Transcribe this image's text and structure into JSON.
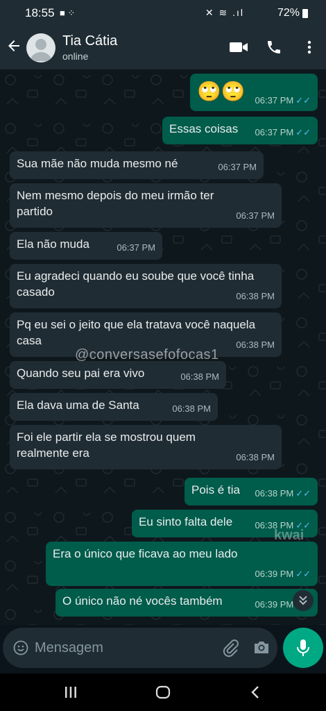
{
  "status_bar": {
    "time": "18:55",
    "left_icons": "■ ⁘",
    "system_icons": "✕ ≋ .ıl",
    "battery": "72%"
  },
  "header": {
    "contact_name": "Tia Cátia",
    "contact_status": "online"
  },
  "messages": [
    {
      "direction": "out",
      "text": "🙄🙄",
      "time": "06:37 PM",
      "read": true
    },
    {
      "direction": "out",
      "text": "Essas coisas",
      "time": "06:37 PM",
      "read": true
    },
    {
      "direction": "in",
      "text": "Sua mãe não muda mesmo né",
      "time": "06:37 PM"
    },
    {
      "direction": "in",
      "text": "Nem mesmo depois do meu irmão ter partido",
      "time": "06:37 PM"
    },
    {
      "direction": "in",
      "text": "Ela não muda",
      "time": "06:37 PM"
    },
    {
      "direction": "in",
      "text": "Eu agradeci quando eu soube que você tinha casado",
      "time": "06:38 PM"
    },
    {
      "direction": "in",
      "text": "Pq eu sei o jeito que ela tratava você naquela casa",
      "time": "06:38 PM"
    },
    {
      "direction": "in",
      "text": "Quando seu pai era vivo",
      "time": "06:38 PM"
    },
    {
      "direction": "in",
      "text": "Ela dava uma de Santa",
      "time": "06:38 PM"
    },
    {
      "direction": "in",
      "text": "Foi ele partir ela se mostrou quem realmente era",
      "time": "06:38 PM"
    },
    {
      "direction": "out",
      "text": "Pois é tia",
      "time": "06:38 PM",
      "read": true
    },
    {
      "direction": "out",
      "text": "Eu sinto falta dele",
      "time": "06:38 PM",
      "read": true
    },
    {
      "direction": "out",
      "text": "Era o único que ficava ao meu lado",
      "time": "06:39 PM",
      "read": true
    },
    {
      "direction": "out",
      "text": "O único não né vocês também",
      "time": "06:39 PM",
      "read": true
    }
  ],
  "overlays": {
    "watermark": "@conversasefofocas1",
    "kwai": "kwai"
  },
  "composer": {
    "placeholder": "Mensagem"
  },
  "colors": {
    "outgoing_bubble": "#005c4b",
    "incoming_bubble": "#202c33",
    "accent": "#00a884",
    "read_ticks": "#53bdeb"
  }
}
